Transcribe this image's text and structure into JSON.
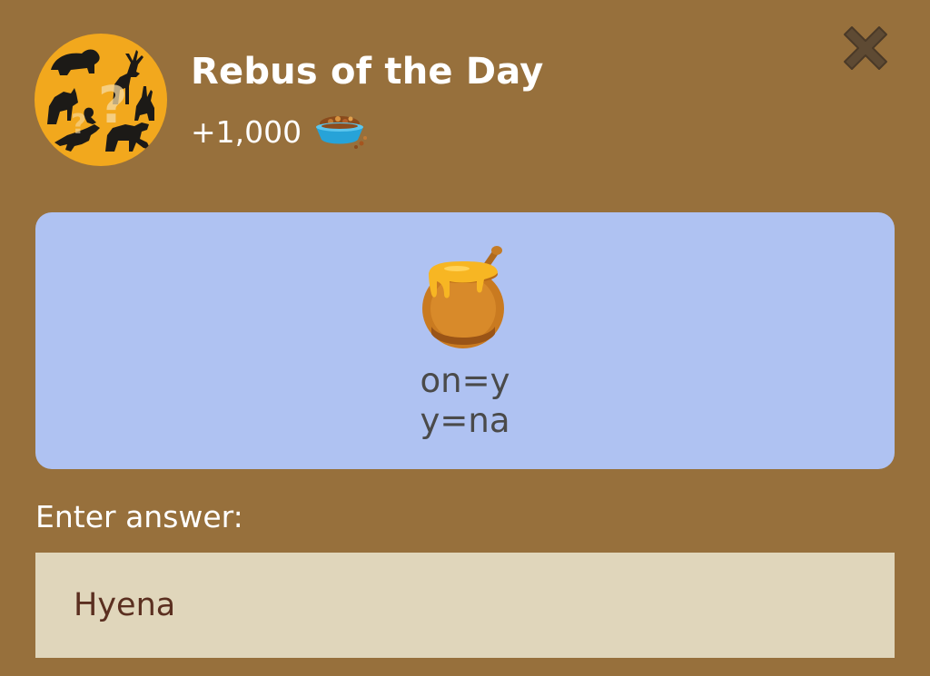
{
  "header": {
    "title": "Rebus of the Day",
    "reward": "+1,000",
    "reward_icon": "pet-food-bowl-icon",
    "badge_icon": "animal-silhouettes-question-icon",
    "close_icon": "close-icon"
  },
  "puzzle": {
    "image_icon": "honey-pot-icon",
    "clue_line_1": "on=y",
    "clue_line_2": "y=na"
  },
  "answer": {
    "label": "Enter answer:",
    "value": "Hyena"
  },
  "colors": {
    "background": "#97703c",
    "badge": "#f2a81d",
    "card": "#afc2f2",
    "input_background": "#e0d6bb",
    "input_text": "#5b2f20",
    "close_icon": "#5e4a33"
  }
}
